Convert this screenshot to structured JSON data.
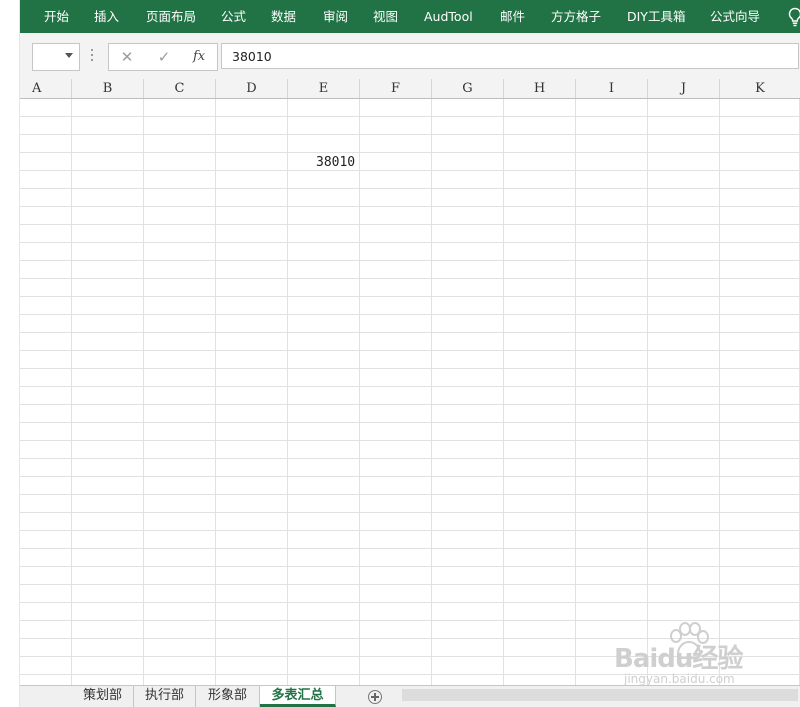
{
  "ribbon": {
    "tabs": [
      "开始",
      "插入",
      "页面布局",
      "公式",
      "数据",
      "审阅",
      "视图",
      "AudTool",
      "邮件",
      "方方格子",
      "DIY工具箱",
      "公式向导"
    ],
    "accent": "#217346",
    "help_icon": "lightbulb-icon"
  },
  "formula_bar": {
    "cancel_glyph": "✕",
    "enter_glyph": "✓",
    "fx_label": "fx",
    "value": "38010"
  },
  "columns": [
    "A",
    "B",
    "C",
    "D",
    "E",
    "F",
    "G",
    "H",
    "I",
    "J",
    "K"
  ],
  "cells": {
    "E4": "38010"
  },
  "sheets": {
    "tabs": [
      "策划部",
      "执行部",
      "形象部",
      "多表汇总"
    ],
    "active": "多表汇总"
  },
  "watermark": {
    "brand": "Baidu经验",
    "url": "jingyan.baidu.com"
  }
}
